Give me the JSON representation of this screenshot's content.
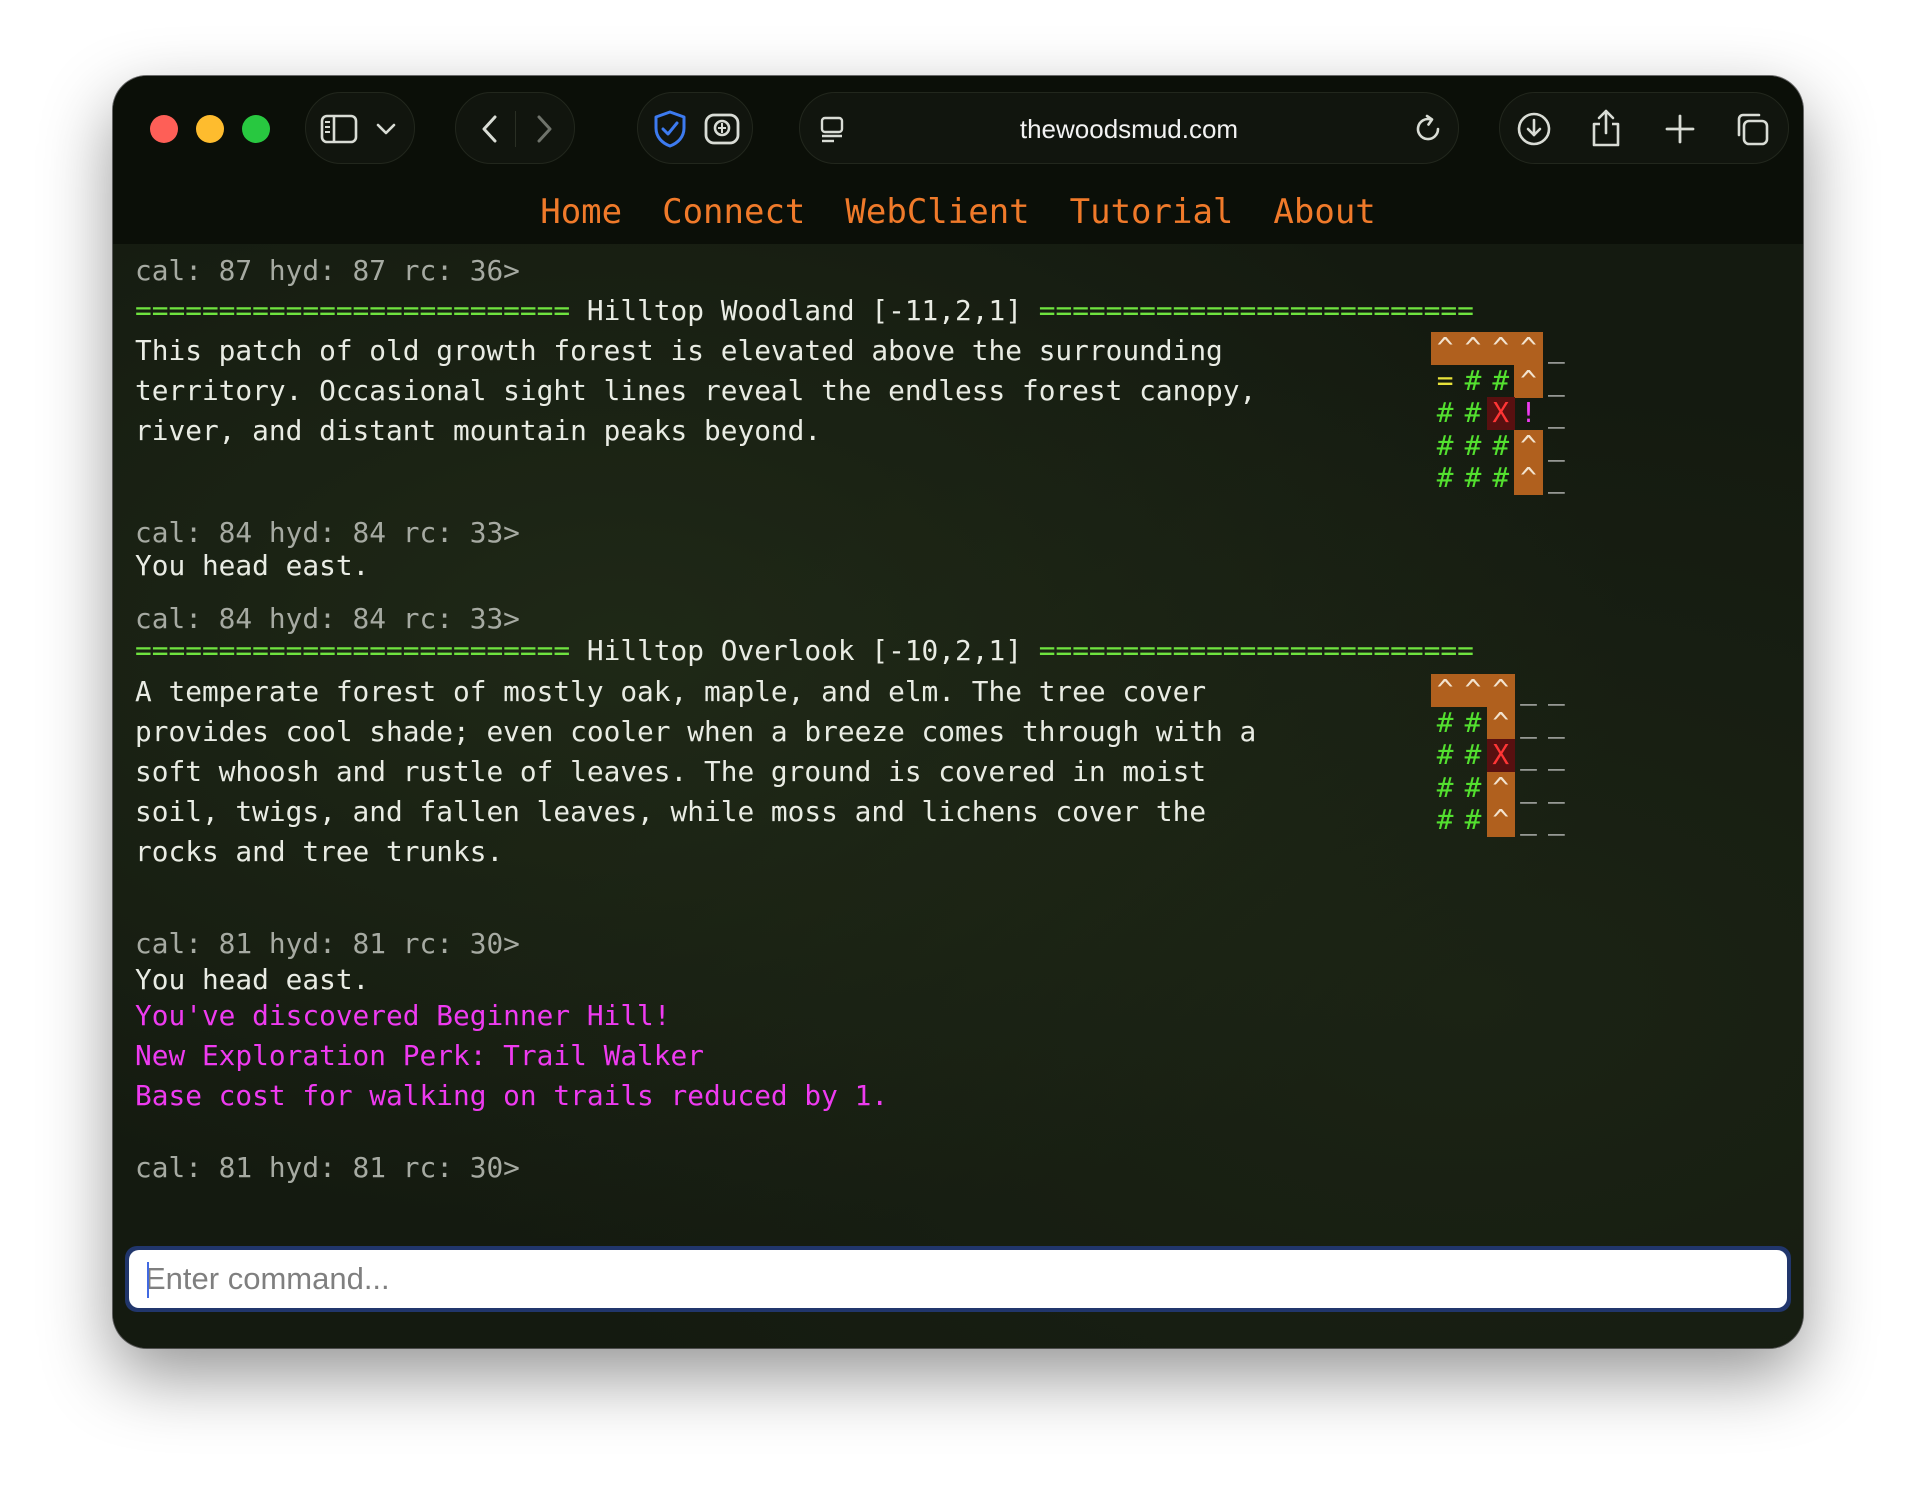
{
  "browser": {
    "url": "thewoodsmud.com",
    "icons": {
      "sidebar": "sidebar-icon",
      "chevron": "chevron-down-icon",
      "back": "back-arrow-icon",
      "forward": "forward-arrow-icon",
      "shield": "shield-check-icon",
      "extension": "extension-icon",
      "reader": "reader-icon",
      "reload": "reload-icon",
      "download": "download-icon",
      "share": "share-icon",
      "newtab": "plus-icon",
      "tabs": "tabs-overview-icon"
    }
  },
  "nav": {
    "items": [
      {
        "label": "Home"
      },
      {
        "label": "Connect"
      },
      {
        "label": "WebClient"
      },
      {
        "label": "Tutorial"
      },
      {
        "label": "About"
      }
    ]
  },
  "terminal": {
    "lines": [
      {
        "text": "cal: 87 hyd: 87 rc: 36>",
        "kind": "prompt"
      },
      {
        "text": "========================== Hilltop Woodland [-11,2,1] ==========================",
        "kind": "room-header"
      },
      {
        "text": "This patch of old growth forest is elevated above the surrounding",
        "kind": "desc"
      },
      {
        "text": "territory. Occasional sight lines reveal the endless forest canopy,",
        "kind": "desc"
      },
      {
        "text": "river, and distant mountain peaks beyond.",
        "kind": "desc"
      },
      {
        "text": "cal: 84 hyd: 84 rc: 33>",
        "kind": "prompt"
      },
      {
        "text": "You head east.",
        "kind": "text"
      },
      {
        "text": "cal: 84 hyd: 84 rc: 33>",
        "kind": "prompt"
      },
      {
        "text": "========================== Hilltop Overlook [-10,2,1] ==========================",
        "kind": "room-header"
      },
      {
        "text": "A temperate forest of mostly oak, maple, and elm. The tree cover",
        "kind": "desc"
      },
      {
        "text": "provides cool shade; even cooler when a breeze comes through with a",
        "kind": "desc"
      },
      {
        "text": "soft whoosh and rustle of leaves. The ground is covered in moist",
        "kind": "desc"
      },
      {
        "text": "soil, twigs, and fallen leaves, while moss and lichens cover the",
        "kind": "desc"
      },
      {
        "text": "rocks and tree trunks.",
        "kind": "desc"
      },
      {
        "text": "cal: 81 hyd: 81 rc: 30>",
        "kind": "prompt"
      },
      {
        "text": "You head east.",
        "kind": "text"
      },
      {
        "text": "You've discovered Beginner Hill!",
        "kind": "notice"
      },
      {
        "text": "New Exploration Perk: Trail Walker",
        "kind": "notice"
      },
      {
        "text": "Base cost for walking on trails reduced by 1.",
        "kind": "notice"
      },
      {
        "text": "cal: 81 hyd: 81 rc: 30>",
        "kind": "prompt"
      }
    ]
  },
  "maps": [
    {
      "name": "map-hilltop-woodland",
      "rows": [
        [
          {
            "t": "^",
            "c": "brown"
          },
          {
            "t": "^",
            "c": "brown"
          },
          {
            "t": "^",
            "c": "brown"
          },
          {
            "t": "^",
            "c": "brown"
          },
          {
            "t": "_",
            "c": "under"
          }
        ],
        [
          {
            "t": "=",
            "c": "eq"
          },
          {
            "t": "#",
            "c": "tree"
          },
          {
            "t": "#",
            "c": "tree"
          },
          {
            "t": "^",
            "c": "brown"
          },
          {
            "t": "_",
            "c": "under"
          }
        ],
        [
          {
            "t": "#",
            "c": "tree"
          },
          {
            "t": "#",
            "c": "tree"
          },
          {
            "t": "X",
            "c": "x"
          },
          {
            "t": "!",
            "c": "bang"
          },
          {
            "t": "_",
            "c": "under"
          }
        ],
        [
          {
            "t": "#",
            "c": "tree"
          },
          {
            "t": "#",
            "c": "tree"
          },
          {
            "t": "#",
            "c": "tree"
          },
          {
            "t": "^",
            "c": "brown"
          },
          {
            "t": "_",
            "c": "under"
          }
        ],
        [
          {
            "t": "#",
            "c": "tree"
          },
          {
            "t": "#",
            "c": "tree"
          },
          {
            "t": "#",
            "c": "tree"
          },
          {
            "t": "^",
            "c": "brown"
          },
          {
            "t": "_",
            "c": "under"
          }
        ]
      ]
    },
    {
      "name": "map-hilltop-overlook",
      "rows": [
        [
          {
            "t": "^",
            "c": "brown"
          },
          {
            "t": "^",
            "c": "brown"
          },
          {
            "t": "^",
            "c": "brown"
          },
          {
            "t": "_",
            "c": "under"
          },
          {
            "t": "_",
            "c": "under"
          }
        ],
        [
          {
            "t": "#",
            "c": "tree"
          },
          {
            "t": "#",
            "c": "tree"
          },
          {
            "t": "^",
            "c": "brown"
          },
          {
            "t": "_",
            "c": "under"
          },
          {
            "t": "_",
            "c": "under"
          }
        ],
        [
          {
            "t": "#",
            "c": "tree"
          },
          {
            "t": "#",
            "c": "tree"
          },
          {
            "t": "X",
            "c": "x"
          },
          {
            "t": "_",
            "c": "under"
          },
          {
            "t": "_",
            "c": "under"
          }
        ],
        [
          {
            "t": "#",
            "c": "tree"
          },
          {
            "t": "#",
            "c": "tree"
          },
          {
            "t": "^",
            "c": "brown"
          },
          {
            "t": "_",
            "c": "under"
          },
          {
            "t": "_",
            "c": "under"
          }
        ],
        [
          {
            "t": "#",
            "c": "tree"
          },
          {
            "t": "#",
            "c": "tree"
          },
          {
            "t": "^",
            "c": "brown"
          },
          {
            "t": "_",
            "c": "under"
          },
          {
            "t": "_",
            "c": "under"
          }
        ]
      ]
    }
  ],
  "command": {
    "placeholder": "Enter command..."
  },
  "colors": {
    "nav_link": "#f07a2a",
    "prompt": "#a6aaa2",
    "separator": "#6fe33f",
    "notice": "#ee3bf0",
    "map_brown": "#b0601e",
    "map_tree": "#53e02f",
    "map_x_bg": "#581010"
  }
}
